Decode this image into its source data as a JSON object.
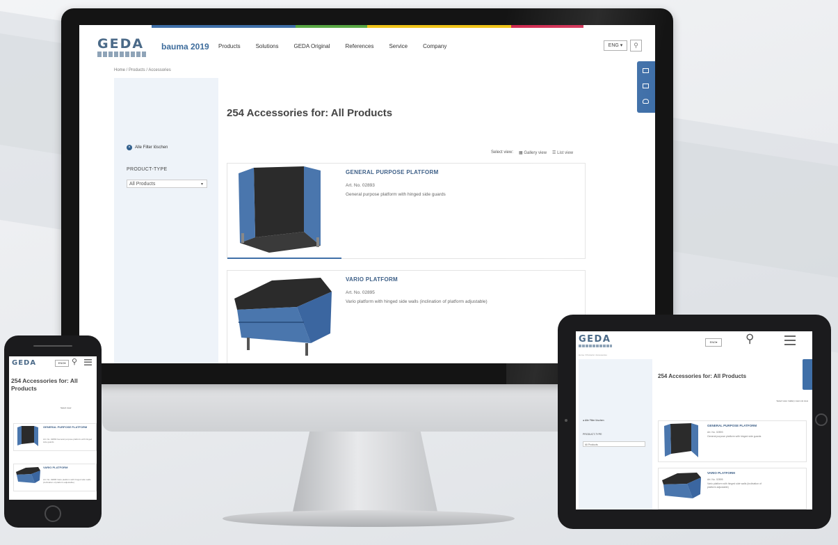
{
  "colors": {
    "brand_blue": "#3f6fa8",
    "logo": "#4b6a88",
    "strip": [
      "#3f6fa8",
      "#3f6fa8",
      "#5aa845",
      "#f0c419",
      "#f0c419",
      "#d0294f",
      "#ffffff"
    ]
  },
  "desktop": {
    "logo": "GEDA",
    "bauma": "bauma 2019",
    "nav": [
      "Products",
      "Solutions",
      "GEDA Original",
      "References",
      "Service",
      "Company"
    ],
    "language": "ENG",
    "search_icon": "search-icon",
    "breadcrumb": "Home / Products / Accessories",
    "filter_toggle": "Alle Filter löschen",
    "product_type_label": "PRODUCT-TYPE",
    "product_type_value": "All Products",
    "heading": "254 Accessories for: All Products",
    "view": {
      "label": "Select view:",
      "gallery": "Gallery view",
      "list": "List view"
    },
    "side_tabs": [
      "mail-icon",
      "catalog-icon",
      "lightbulb-icon"
    ],
    "products": [
      {
        "title": "GENERAL PURPOSE PLATFORM",
        "art": "Art. No. 02893",
        "desc": "General purpose platform with hinged side guards"
      },
      {
        "title": "VARIO PLATFORM",
        "art": "Art. No. 02895",
        "desc": "Vario platform with hinged side walls (inclination of platform adjustable)"
      }
    ]
  },
  "phone": {
    "logo": "GEDA",
    "language": "ENG",
    "heading": "254 Accessories for: All Products",
    "view": "Select view:",
    "products": [
      {
        "title": "GENERAL PURPOSE PLATFORM",
        "desc": "Art. No. 02893 General purpose platform with hinged side guards"
      },
      {
        "title": "VARIO PLATFORM",
        "desc": "Art. No. 02895 Vario platform with hinged side walls (inclination of platform adjustable)"
      }
    ]
  },
  "tablet": {
    "logo": "GEDA",
    "language": "ENG",
    "breadcrumb": "Home / Products / Accessories",
    "heading": "254 Accessories for: All Products",
    "filter_toggle": "Alle Filter löschen",
    "product_type_label": "PRODUCT-TYPE",
    "product_type_value": "All Products",
    "view": "Select view: Gallery view List view",
    "products": [
      {
        "title": "GENERAL PURPOSE PLATFORM",
        "art": "Art. No. 02893",
        "desc": "General purpose platform with hinged side guards"
      },
      {
        "title": "VARIO PLATFORM",
        "art": "Art. No. 02895",
        "desc": "Vario platform with hinged side walls (inclination of platform adjustable)"
      }
    ]
  }
}
